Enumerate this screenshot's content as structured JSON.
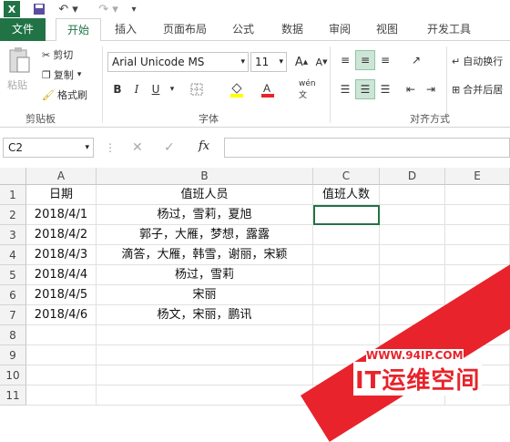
{
  "titlebar": {
    "icons": [
      "excel-logo-icon",
      "save-icon",
      "undo-icon",
      "redo-icon",
      "customize-icon"
    ]
  },
  "tabs": [
    {
      "label": "文件"
    },
    {
      "label": "开始"
    },
    {
      "label": "插入"
    },
    {
      "label": "页面布局"
    },
    {
      "label": "公式"
    },
    {
      "label": "数据"
    },
    {
      "label": "审阅"
    },
    {
      "label": "视图"
    },
    {
      "label": "开发工具"
    }
  ],
  "ribbon": {
    "clipboard": {
      "paste": "粘贴",
      "cut": "剪切",
      "copy": "复制",
      "format_painter": "格式刷",
      "label": "剪贴板"
    },
    "font": {
      "name": "Arial Unicode MS",
      "size": "11",
      "label": "字体",
      "wen": "wén 文"
    },
    "alignment": {
      "wrap": "自动换行",
      "merge": "合并后居",
      "label": "对齐方式"
    }
  },
  "formula_bar": {
    "name_box": "C2",
    "fx": "fx",
    "value": ""
  },
  "sheet": {
    "columns": [
      "A",
      "B",
      "C",
      "D",
      "E"
    ],
    "rows": [
      "1",
      "2",
      "3",
      "4",
      "5",
      "6",
      "7",
      "8",
      "9",
      "10",
      "11"
    ],
    "cells": [
      [
        "日期",
        "值班人员",
        "值班人数",
        "",
        ""
      ],
      [
        "2018/4/1",
        "杨过，雪莉，夏旭",
        "",
        "",
        ""
      ],
      [
        "2018/4/2",
        "郭子，大雁，梦想，露露",
        "",
        "",
        ""
      ],
      [
        "2018/4/3",
        "滴答，大雁，韩雪，谢丽，宋颖",
        "",
        "",
        ""
      ],
      [
        "2018/4/4",
        "杨过，雪莉",
        "",
        "",
        ""
      ],
      [
        "2018/4/5",
        "宋丽",
        "",
        "",
        ""
      ],
      [
        "2018/4/6",
        "杨文，宋丽，鹏讯",
        "",
        "",
        ""
      ],
      [
        "",
        "",
        "",
        "",
        ""
      ],
      [
        "",
        "",
        "",
        "",
        ""
      ],
      [
        "",
        "",
        "",
        "",
        ""
      ],
      [
        "",
        "",
        "",
        "",
        ""
      ]
    ]
  },
  "watermark": {
    "url": "WWW.94IP.COM",
    "text": "IT运维空间"
  },
  "colors": {
    "accent": "#217346",
    "watermark": "#e8232b"
  }
}
